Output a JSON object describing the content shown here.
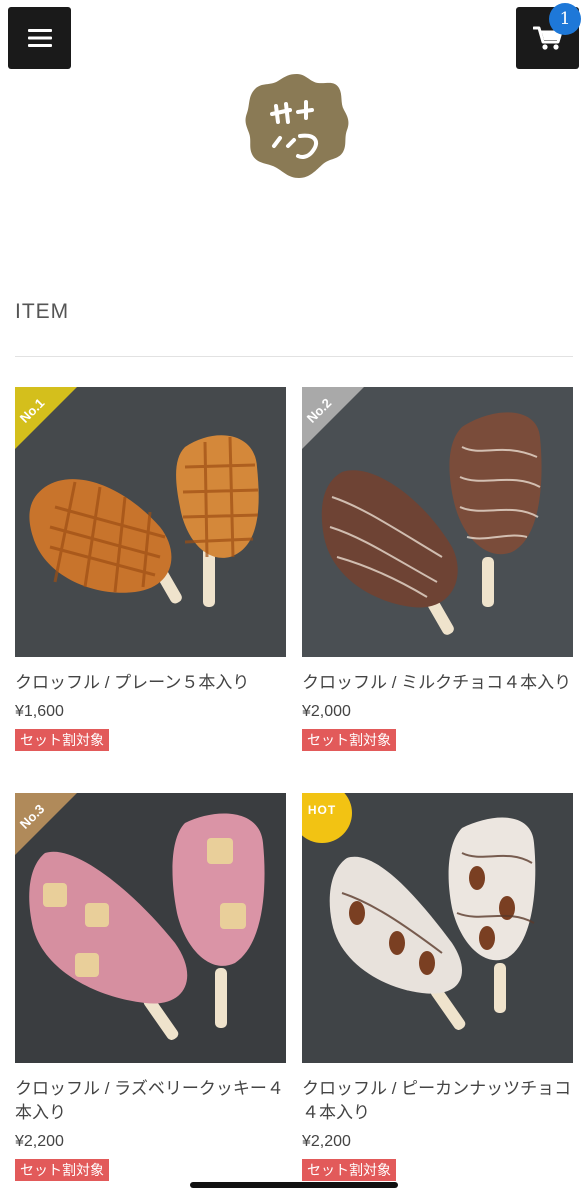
{
  "header": {
    "menu_icon": "hamburger-menu-icon",
    "cart_icon": "shopping-cart-icon",
    "cart_count": "1"
  },
  "logo": {
    "text": "サクッ"
  },
  "section": {
    "title": "ITEM"
  },
  "products": [
    {
      "name": "クロッフル / プレーン５本入り",
      "price": "¥1,600",
      "tag": "セット割対象",
      "badge": "No.1",
      "badge_color": "#d4bf1c"
    },
    {
      "name": "クロッフル / ミルクチョコ４本入り",
      "price": "¥2,000",
      "tag": "セット割対象",
      "badge": "No.2",
      "badge_color": "#a9a9a9"
    },
    {
      "name": "クロッフル / ラズベリークッキー４本入り",
      "price": "¥2,200",
      "tag": "セット割対象",
      "badge": "No.3",
      "badge_color": "#b08a5a"
    },
    {
      "name": "クロッフル / ピーカンナッツチョコ４本入り",
      "price": "¥2,200",
      "tag": "セット割対象",
      "badge": "HOT",
      "badge_color": "#f2c313"
    }
  ],
  "colors": {
    "header_button": "#1a1a1a",
    "cart_badge": "#1e78d8",
    "logo": "#8a7a55",
    "tag": "#e25a5a"
  }
}
